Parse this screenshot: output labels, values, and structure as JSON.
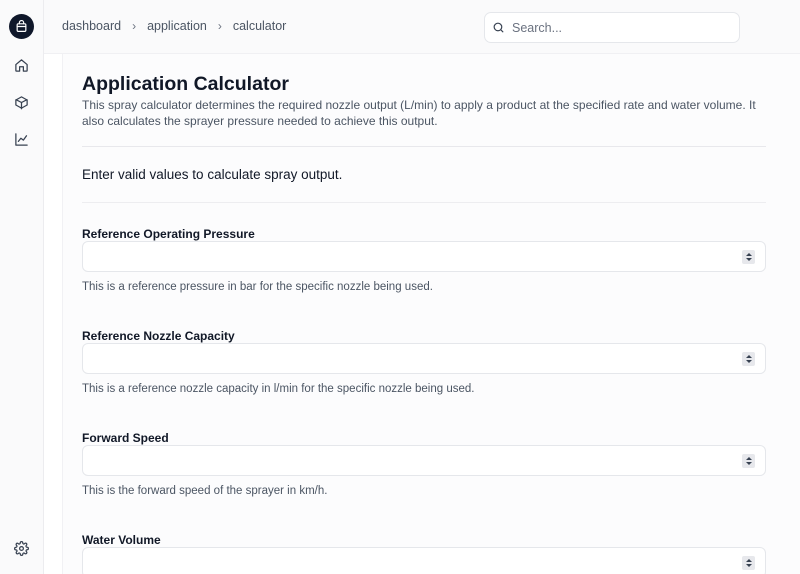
{
  "rail": {
    "icons": [
      "bag-icon",
      "home-icon",
      "box-icon",
      "chart-icon",
      "gear-icon"
    ]
  },
  "breadcrumb": [
    "dashboard",
    "application",
    "calculator"
  ],
  "search": {
    "placeholder": "Search..."
  },
  "page": {
    "title": "Application Calculator",
    "description": "This spray calculator determines the required nozzle output (L/min) to apply a product at the specified rate and water volume. It also calculates the sprayer pressure needed to achieve this output.",
    "status": "Enter valid values to calculate spray output."
  },
  "fields": [
    {
      "label": "Reference Operating Pressure",
      "value": "",
      "help": "This is a reference pressure in bar for the specific nozzle being used."
    },
    {
      "label": "Reference Nozzle Capacity",
      "value": "",
      "help": "This is a reference nozzle capacity in l/min for the specific nozzle being used."
    },
    {
      "label": "Forward Speed",
      "value": "",
      "help": "This is the forward speed of the sprayer in km/h."
    },
    {
      "label": "Water Volume",
      "value": ""
    }
  ]
}
